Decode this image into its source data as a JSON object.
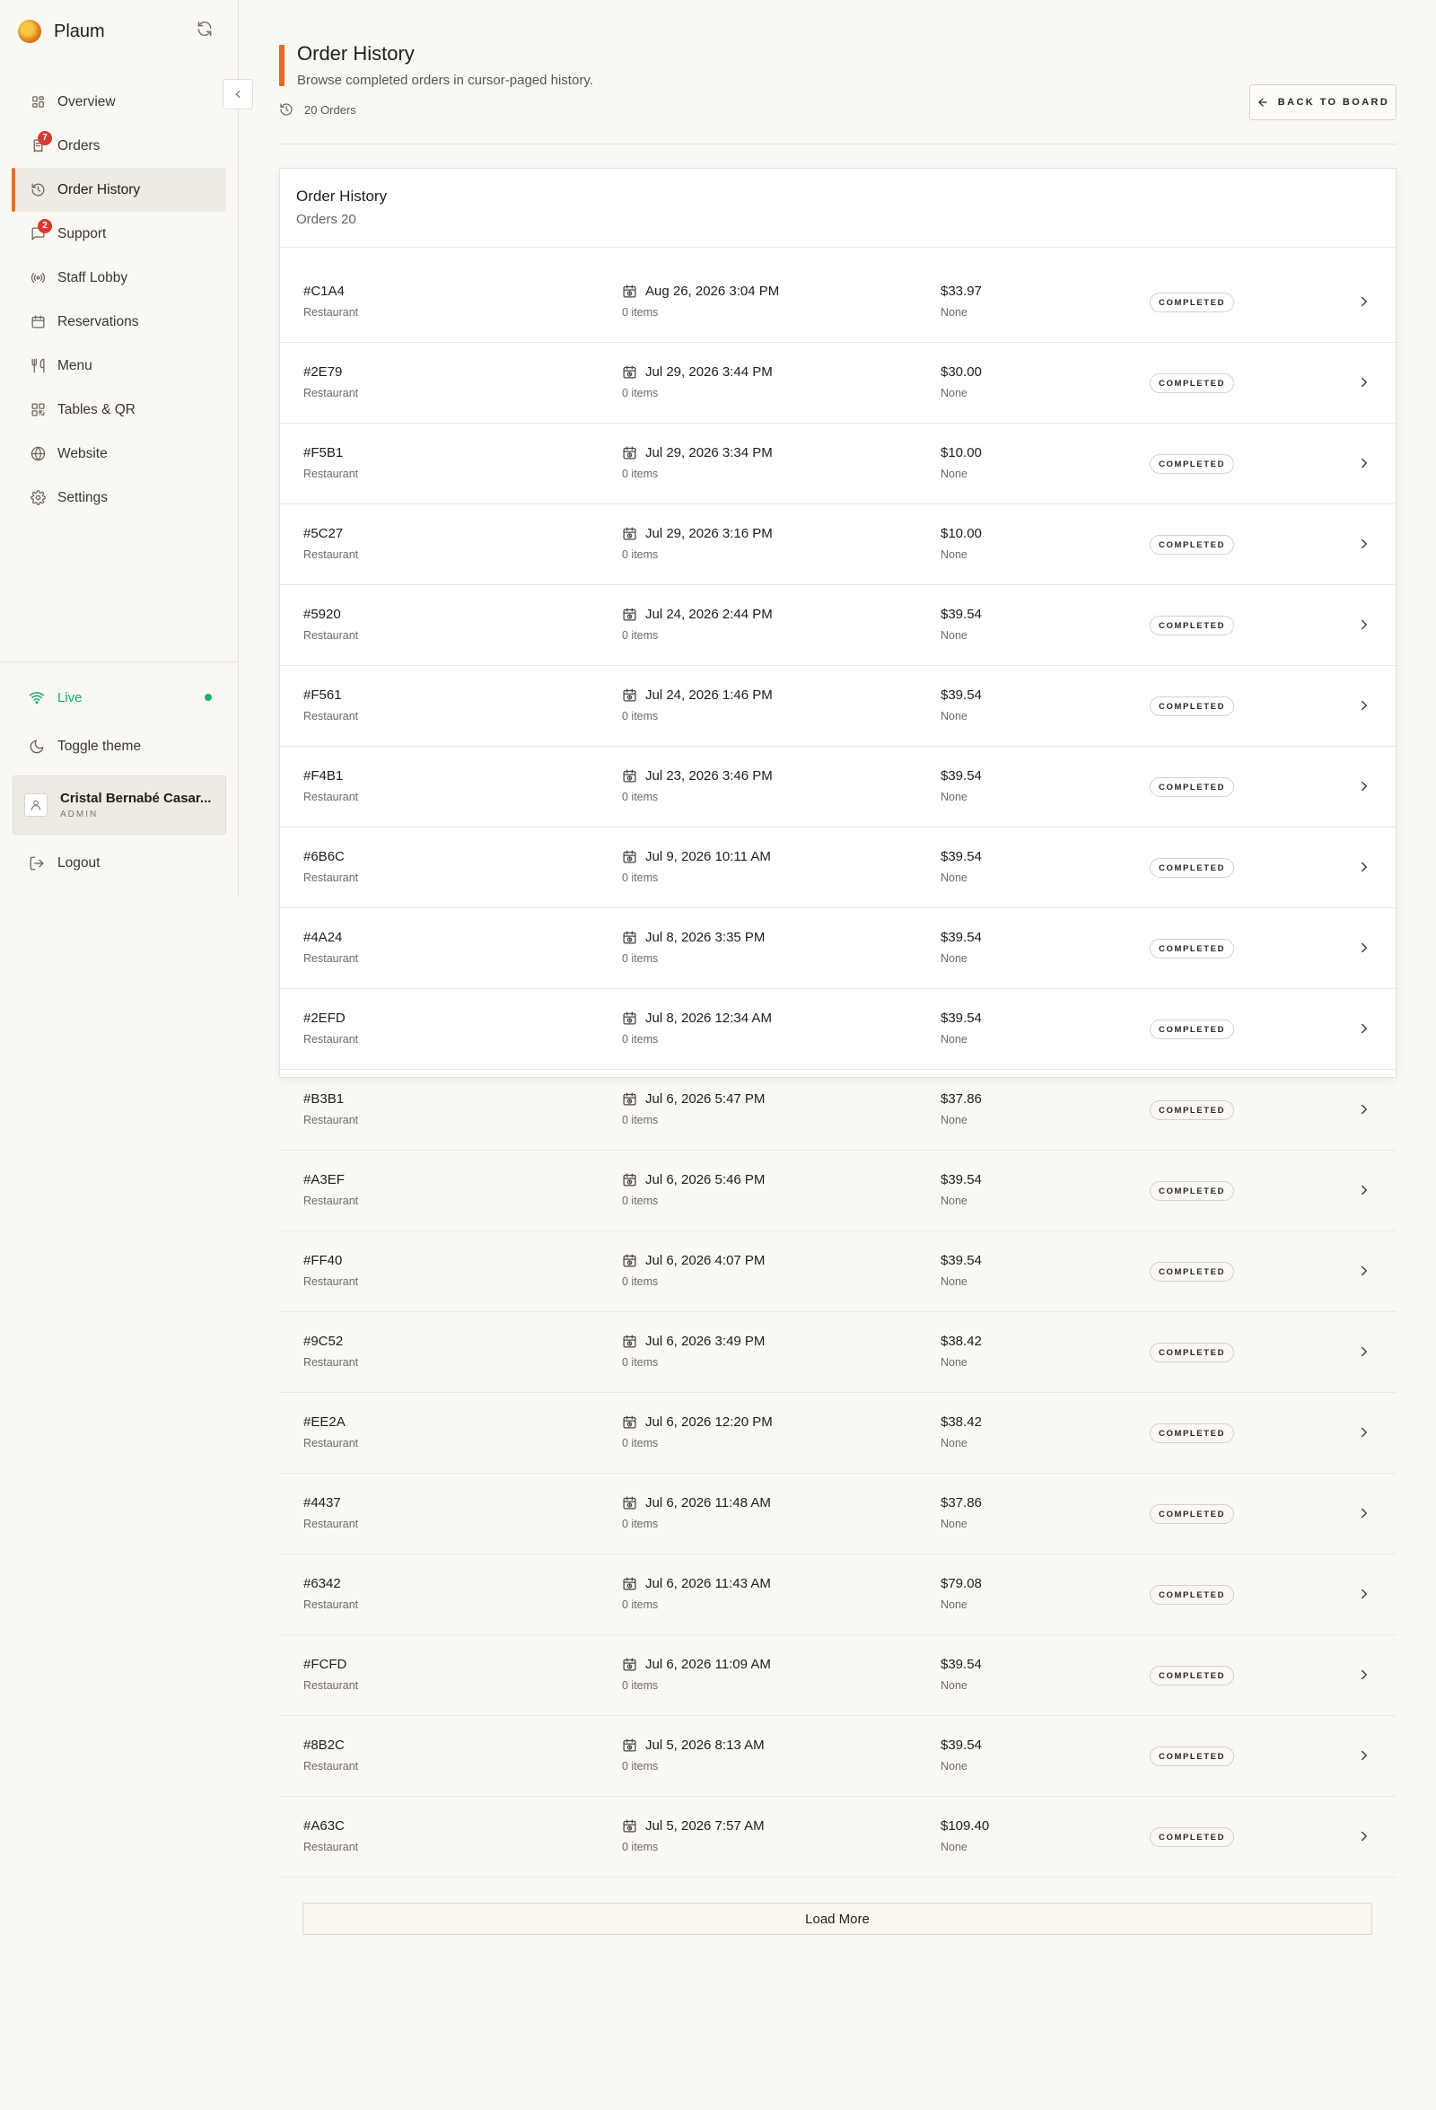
{
  "app": {
    "name": "Plaum"
  },
  "nav": [
    {
      "label": "Overview",
      "icon": "grid-icon"
    },
    {
      "label": "Orders",
      "icon": "receipt-icon",
      "badge": "7"
    },
    {
      "label": "Order History",
      "icon": "history-icon",
      "active": true
    },
    {
      "label": "Support",
      "icon": "message-icon",
      "badge": "2"
    },
    {
      "label": "Staff Lobby",
      "icon": "radio-icon"
    },
    {
      "label": "Reservations",
      "icon": "calendar-icon"
    },
    {
      "label": "Menu",
      "icon": "utensils-icon"
    },
    {
      "label": "Tables & QR",
      "icon": "qr-icon"
    },
    {
      "label": "Website",
      "icon": "globe-icon"
    },
    {
      "label": "Settings",
      "icon": "gear-icon"
    }
  ],
  "sidebar_footer": {
    "live": "Live",
    "toggle_theme": "Toggle theme",
    "user_name": "Cristal Bernabé Casar...",
    "user_role": "ADMIN",
    "logout": "Logout"
  },
  "header": {
    "title": "Order History",
    "subtitle": "Browse completed orders in cursor-paged history.",
    "count": "20 Orders",
    "back_label": "BACK TO BOARD"
  },
  "card": {
    "title": "Order History",
    "subtitle": "Orders 20",
    "load_more": "Load More"
  },
  "colors": {
    "accent": "#e56b1f",
    "live": "#19b26b",
    "badge": "#d93a2e"
  },
  "orders": [
    {
      "id": "#C1A4",
      "type": "Restaurant",
      "date": "Aug 26, 2026 3:04 PM",
      "items": "0 items",
      "total": "$33.97",
      "payment": "None",
      "status": "COMPLETED"
    },
    {
      "id": "#2E79",
      "type": "Restaurant",
      "date": "Jul 29, 2026 3:44 PM",
      "items": "0 items",
      "total": "$30.00",
      "payment": "None",
      "status": "COMPLETED"
    },
    {
      "id": "#F5B1",
      "type": "Restaurant",
      "date": "Jul 29, 2026 3:34 PM",
      "items": "0 items",
      "total": "$10.00",
      "payment": "None",
      "status": "COMPLETED"
    },
    {
      "id": "#5C27",
      "type": "Restaurant",
      "date": "Jul 29, 2026 3:16 PM",
      "items": "0 items",
      "total": "$10.00",
      "payment": "None",
      "status": "COMPLETED"
    },
    {
      "id": "#5920",
      "type": "Restaurant",
      "date": "Jul 24, 2026 2:44 PM",
      "items": "0 items",
      "total": "$39.54",
      "payment": "None",
      "status": "COMPLETED"
    },
    {
      "id": "#F561",
      "type": "Restaurant",
      "date": "Jul 24, 2026 1:46 PM",
      "items": "0 items",
      "total": "$39.54",
      "payment": "None",
      "status": "COMPLETED"
    },
    {
      "id": "#F4B1",
      "type": "Restaurant",
      "date": "Jul 23, 2026 3:46 PM",
      "items": "0 items",
      "total": "$39.54",
      "payment": "None",
      "status": "COMPLETED"
    },
    {
      "id": "#6B6C",
      "type": "Restaurant",
      "date": "Jul 9, 2026 10:11 AM",
      "items": "0 items",
      "total": "$39.54",
      "payment": "None",
      "status": "COMPLETED"
    },
    {
      "id": "#4A24",
      "type": "Restaurant",
      "date": "Jul 8, 2026 3:35 PM",
      "items": "0 items",
      "total": "$39.54",
      "payment": "None",
      "status": "COMPLETED"
    },
    {
      "id": "#2EFD",
      "type": "Restaurant",
      "date": "Jul 8, 2026 12:34 AM",
      "items": "0 items",
      "total": "$39.54",
      "payment": "None",
      "status": "COMPLETED"
    },
    {
      "id": "#B3B1",
      "type": "Restaurant",
      "date": "Jul 6, 2026 5:47 PM",
      "items": "0 items",
      "total": "$37.86",
      "payment": "None",
      "status": "COMPLETED"
    },
    {
      "id": "#A3EF",
      "type": "Restaurant",
      "date": "Jul 6, 2026 5:46 PM",
      "items": "0 items",
      "total": "$39.54",
      "payment": "None",
      "status": "COMPLETED"
    },
    {
      "id": "#FF40",
      "type": "Restaurant",
      "date": "Jul 6, 2026 4:07 PM",
      "items": "0 items",
      "total": "$39.54",
      "payment": "None",
      "status": "COMPLETED"
    },
    {
      "id": "#9C52",
      "type": "Restaurant",
      "date": "Jul 6, 2026 3:49 PM",
      "items": "0 items",
      "total": "$38.42",
      "payment": "None",
      "status": "COMPLETED"
    },
    {
      "id": "#EE2A",
      "type": "Restaurant",
      "date": "Jul 6, 2026 12:20 PM",
      "items": "0 items",
      "total": "$38.42",
      "payment": "None",
      "status": "COMPLETED"
    },
    {
      "id": "#4437",
      "type": "Restaurant",
      "date": "Jul 6, 2026 11:48 AM",
      "items": "0 items",
      "total": "$37.86",
      "payment": "None",
      "status": "COMPLETED"
    },
    {
      "id": "#6342",
      "type": "Restaurant",
      "date": "Jul 6, 2026 11:43 AM",
      "items": "0 items",
      "total": "$79.08",
      "payment": "None",
      "status": "COMPLETED"
    },
    {
      "id": "#FCFD",
      "type": "Restaurant",
      "date": "Jul 6, 2026 11:09 AM",
      "items": "0 items",
      "total": "$39.54",
      "payment": "None",
      "status": "COMPLETED"
    },
    {
      "id": "#8B2C",
      "type": "Restaurant",
      "date": "Jul 5, 2026 8:13 AM",
      "items": "0 items",
      "total": "$39.54",
      "payment": "None",
      "status": "COMPLETED"
    },
    {
      "id": "#A63C",
      "type": "Restaurant",
      "date": "Jul 5, 2026 7:57 AM",
      "items": "0 items",
      "total": "$109.40",
      "payment": "None",
      "status": "COMPLETED"
    }
  ]
}
